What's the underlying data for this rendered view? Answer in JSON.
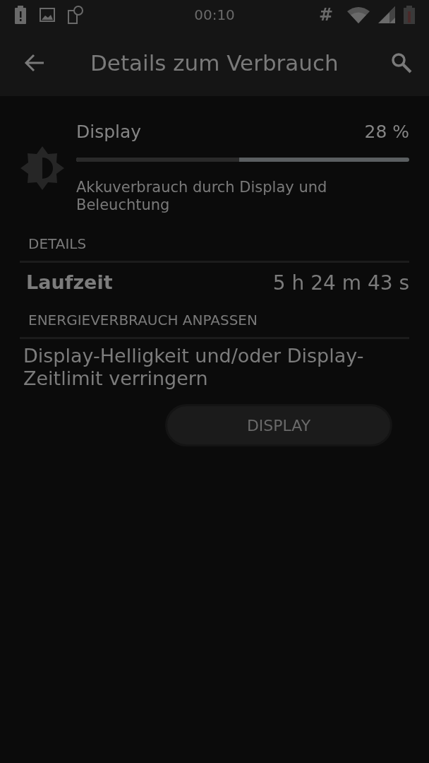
{
  "status_bar": {
    "time": "00:10",
    "hash": "#"
  },
  "app_bar": {
    "title": "Details zum Verbrauch"
  },
  "usage": {
    "name": "Display",
    "percent": "28 %",
    "level": 0.49,
    "description": "Akkuverbrauch durch Display und Beleuchtung"
  },
  "details": {
    "heading": "DETAILS",
    "rows": [
      {
        "label": "Laufzeit",
        "value": "5 h 24 m 43 s"
      }
    ]
  },
  "adjust": {
    "heading": "ENERGIEVERBRAUCH ANPASSEN",
    "text": "Display-Helligkeit und/oder Display-Zeitlimit verringern",
    "button": "DISPLAY"
  }
}
